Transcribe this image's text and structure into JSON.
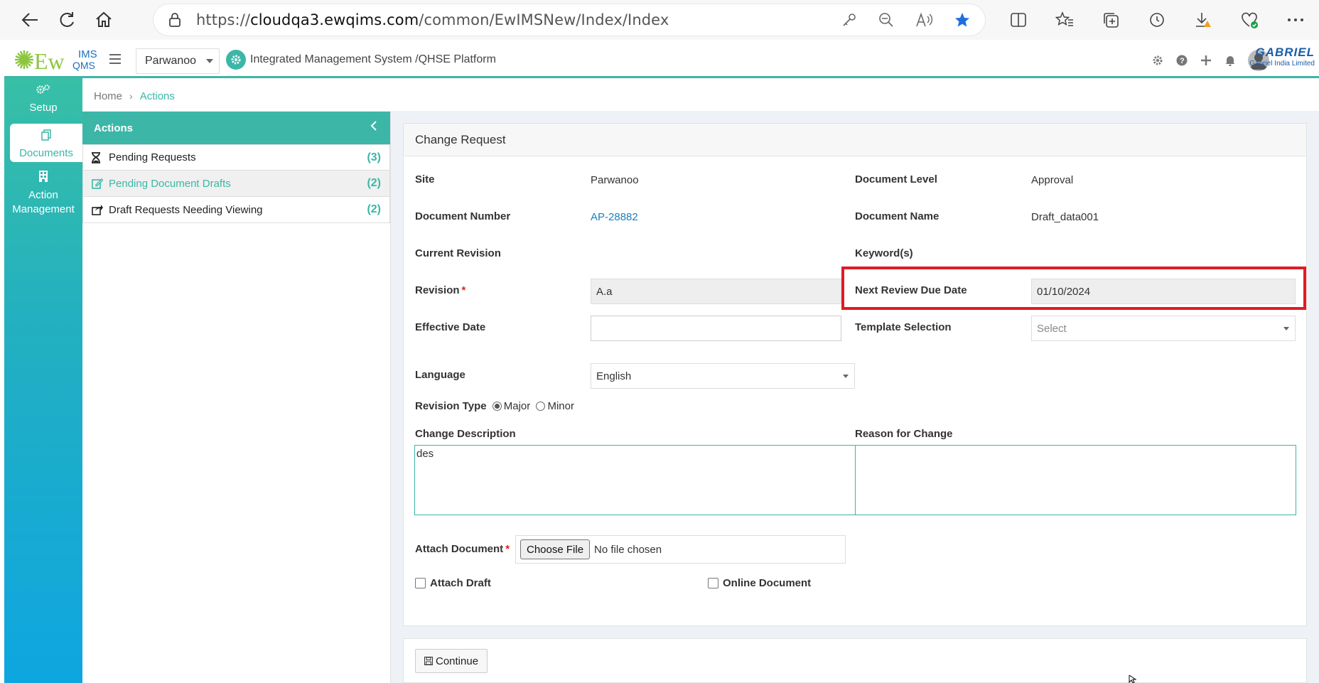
{
  "browser": {
    "url_prefix": "https://",
    "url_host": "cloudqa3.ewqims.com",
    "url_path": "/common/EwIMSNew/Index/Index"
  },
  "header": {
    "logo_main": "Ew",
    "logo_top": "IMS",
    "logo_sub": "QMS",
    "site_selected": "Parwanoo",
    "platform_title": "Integrated Management System /QHSE Platform",
    "brand_name": "GABRIEL",
    "brand_sub": "Gabriel India Limited",
    "accent_color": "#3bb6a7"
  },
  "rail": {
    "items": [
      {
        "label": "Setup",
        "icon": "gears-icon"
      },
      {
        "label": "Documents",
        "icon": "documents-icon"
      },
      {
        "label": "Action Management",
        "icon": "building-icon"
      }
    ]
  },
  "breadcrumb": {
    "home": "Home",
    "current": "Actions"
  },
  "actions": {
    "title": "Actions",
    "items": [
      {
        "label": "Pending Requests",
        "count": "(3)",
        "icon": "hourglass-icon"
      },
      {
        "label": "Pending Document Drafts",
        "count": "(2)",
        "icon": "edit-icon"
      },
      {
        "label": "Draft Requests Needing Viewing",
        "count": "(2)",
        "icon": "share-icon"
      }
    ]
  },
  "form": {
    "title": "Change Request",
    "site_label": "Site",
    "site_value": "Parwanoo",
    "doc_level_label": "Document Level",
    "doc_level_value": "Approval",
    "doc_number_label": "Document Number",
    "doc_number_value": "AP-28882",
    "doc_name_label": "Document Name",
    "doc_name_value": "Draft_data001",
    "current_revision_label": "Current Revision",
    "keywords_label": "Keyword(s)",
    "revision_label": "Revision",
    "revision_value": "A.a",
    "next_review_label": "Next Review Due Date",
    "next_review_value": "01/10/2024",
    "effective_date_label": "Effective Date",
    "effective_date_value": "",
    "template_label": "Template Selection",
    "template_placeholder": "Select",
    "language_label": "Language",
    "language_value": "English",
    "revision_type_label": "Revision Type",
    "revision_major": "Major",
    "revision_minor": "Minor",
    "change_desc_label": "Change Description",
    "change_desc_value": "des",
    "reason_label": "Reason for Change",
    "reason_value": "",
    "attach_label": "Attach Document",
    "choose_file": "Choose File",
    "no_file": "No file chosen",
    "attach_draft": "Attach Draft",
    "online_document": "Online Document",
    "required_mark": "*"
  },
  "footer": {
    "continue_label": "Continue"
  }
}
